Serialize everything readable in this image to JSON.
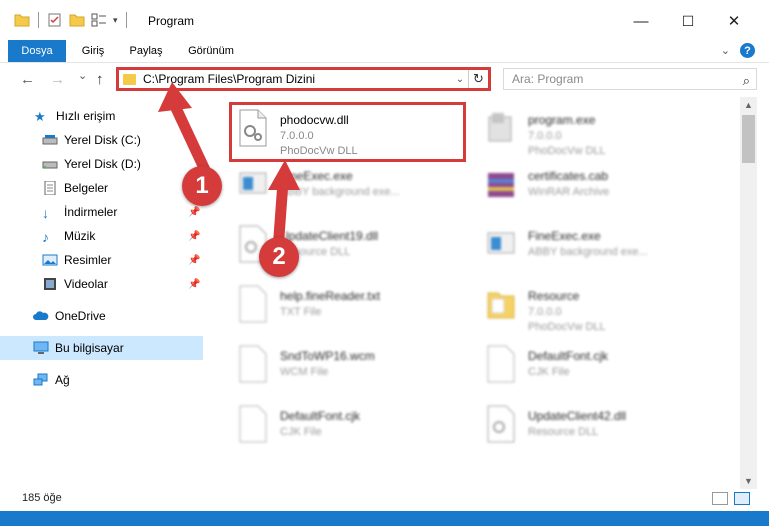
{
  "window": {
    "title": "Program",
    "minimize": "—",
    "maximize": "☐",
    "close": "✕"
  },
  "ribbon": {
    "tabs": [
      {
        "label": "Dosya"
      },
      {
        "label": "Giriş"
      },
      {
        "label": "Paylaş"
      },
      {
        "label": "Görünüm"
      }
    ],
    "help": "?"
  },
  "nav": {
    "back": "←",
    "forward": "→",
    "history": "⌄",
    "up": "↑",
    "address": "C:\\Program Files\\Program Dizini",
    "address_dropdown": "⌄",
    "refresh": "↻",
    "search_placeholder": "Ara: Program",
    "search_icon": "⌕"
  },
  "sidebar": {
    "items": [
      {
        "label": "Hızlı erişim",
        "icon": "star-icon"
      },
      {
        "label": "Yerel Disk (C:)",
        "icon": "drive-icon"
      },
      {
        "label": "Yerel Disk (D:)",
        "icon": "drive-icon"
      },
      {
        "label": "Belgeler",
        "icon": "documents-icon"
      },
      {
        "label": "İndirmeler",
        "icon": "download-icon"
      },
      {
        "label": "Müzik",
        "icon": "music-icon"
      },
      {
        "label": "Resimler",
        "icon": "pictures-icon"
      },
      {
        "label": "Videolar",
        "icon": "video-icon"
      },
      {
        "label": "OneDrive",
        "icon": "cloud-icon"
      },
      {
        "label": "Bu bilgisayar",
        "icon": "computer-icon"
      },
      {
        "label": "Ağ",
        "icon": "network-icon"
      }
    ],
    "pin": "📌"
  },
  "files": [
    {
      "name": "phodocvw.dll",
      "line1": "7.0.0.0",
      "line2": "PhoDocVw DLL",
      "icon": "dll-icon"
    },
    {
      "name": "program.exe",
      "line1": "7.0.0.0",
      "line2": "PhoDocVw DLL",
      "icon": "exe-icon"
    },
    {
      "name": "FineExec.exe",
      "line1": "ABBY background exe...",
      "line2": "",
      "icon": "exe-icon"
    },
    {
      "name": "certificates.cab",
      "line1": "WinRAR Archive",
      "line2": "",
      "icon": "archive-icon"
    },
    {
      "name": "UpdateClient19.dll",
      "line1": "Resource DLL",
      "line2": "",
      "icon": "dll-icon"
    },
    {
      "name": "FineExec.exe",
      "line1": "ABBY background exe...",
      "line2": "",
      "icon": "exe-icon"
    },
    {
      "name": "help.fineReader.txt",
      "line1": "TXT File",
      "line2": "",
      "icon": "text-file-icon"
    },
    {
      "name": "Resource",
      "line1": "7.0.0.0",
      "line2": "PhoDocVw DLL",
      "icon": "folder-icon"
    },
    {
      "name": "SndToWP16.wcm",
      "line1": "WCM File",
      "line2": "",
      "icon": "file-icon"
    },
    {
      "name": "DefaultFont.cjk",
      "line1": "CJK File",
      "line2": "",
      "icon": "file-icon"
    },
    {
      "name": "DefaultFont.cjk",
      "line1": "CJK File",
      "line2": "",
      "icon": "file-icon"
    },
    {
      "name": "UpdateClient42.dll",
      "line1": "Resource DLL",
      "line2": "",
      "icon": "dll-icon"
    }
  ],
  "callouts": [
    "1",
    "2"
  ],
  "status": {
    "count": "185 öğe"
  },
  "colors": {
    "accent": "#1979ca",
    "highlight": "#d63b3b",
    "selected": "#cce8ff"
  }
}
